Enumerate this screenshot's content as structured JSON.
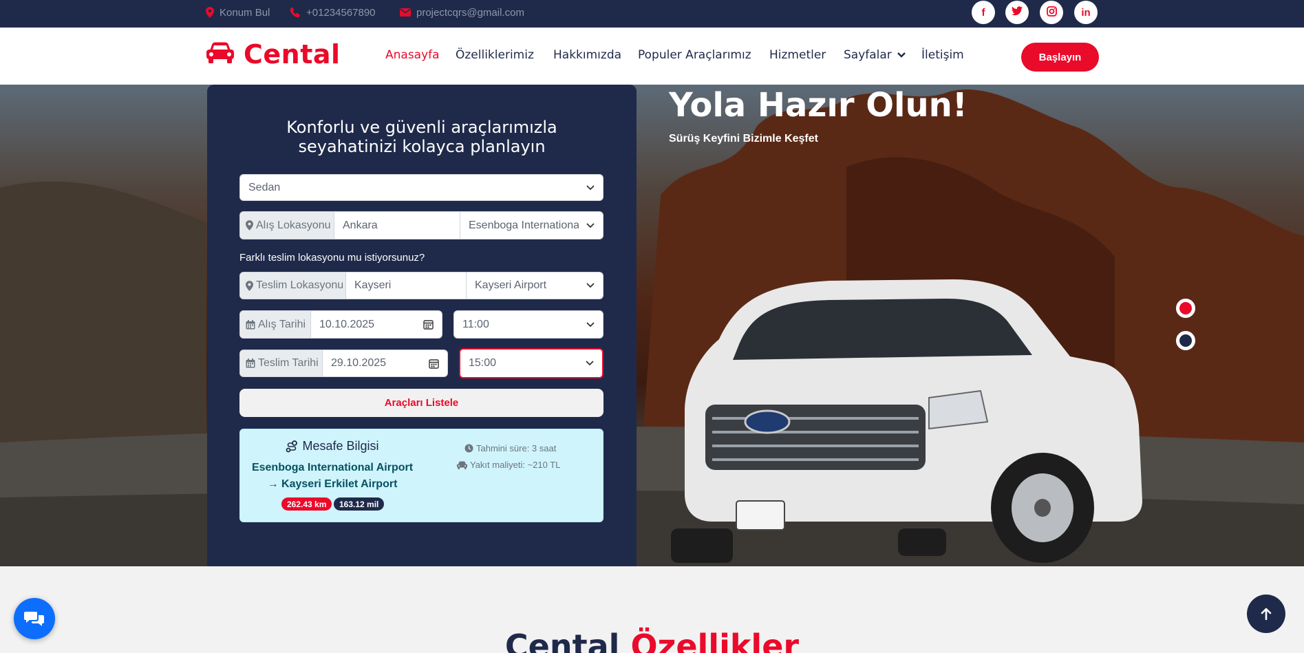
{
  "topbar": {
    "location": "Konum Bul",
    "phone": "+01234567890",
    "email": "projectcqrs@gmail.com",
    "social": [
      {
        "icon": "facebook-icon",
        "glyph": "f"
      },
      {
        "icon": "twitter-icon",
        "glyph": ""
      },
      {
        "icon": "instagram-icon",
        "glyph": ""
      },
      {
        "icon": "linkedin-icon",
        "glyph": "in"
      }
    ]
  },
  "header": {
    "logo": "Cental",
    "nav": [
      "Anasayfa",
      "Özelliklerimiz",
      "Hakkımızda",
      "Populer Araçlarımız",
      "Hizmetler",
      "Sayfalar",
      "İletişim"
    ],
    "cta": "Başlayın"
  },
  "hero": {
    "title": "Yola Hazır Olun!",
    "subtitle": "Sürüş Keyfini Bizimle Keşfet"
  },
  "form": {
    "title_line1": "Konforlu ve güvenli araçlarımızla",
    "title_line2": "seyahatinizi kolayca planlayın",
    "car_type": "Sedan",
    "pickup_label": "Alış Lokasyonu",
    "pickup_city": "Ankara",
    "pickup_place": "Esenboga International Airport",
    "different_dropoff": "Farklı teslim lokasyonu mu istiyorsunuz?",
    "dropoff_label": "Teslim Lokasyonu",
    "dropoff_city": "Kayseri",
    "dropoff_place": "Kayseri Airport",
    "pickup_date_label": "Alış Tarihi",
    "pickup_date": "10.10.2025",
    "pickup_time": "11:00",
    "dropoff_date_label": "Teslim Tarihi",
    "dropoff_date": "29.10.2025",
    "dropoff_time": "15:00",
    "submit": "Araçları Listele"
  },
  "distance": {
    "title": "Mesafe Bilgisi",
    "from": "Esenboga International Airport",
    "to": "→ Kayseri Erkilet Airport",
    "km": "262.43 km",
    "miles": "163.12 mil",
    "duration": "Tahmini süre: 3 saat",
    "fuel": "Yakıt maliyeti: ~210 TL"
  },
  "section": {
    "title_a": "Cental",
    "title_b": "Özellikler"
  },
  "colors": {
    "brand_red": "#ea0a2a",
    "navy": "#1f2a4a",
    "info_bg": "#cff4fc",
    "chat_blue": "#0d6efd"
  }
}
